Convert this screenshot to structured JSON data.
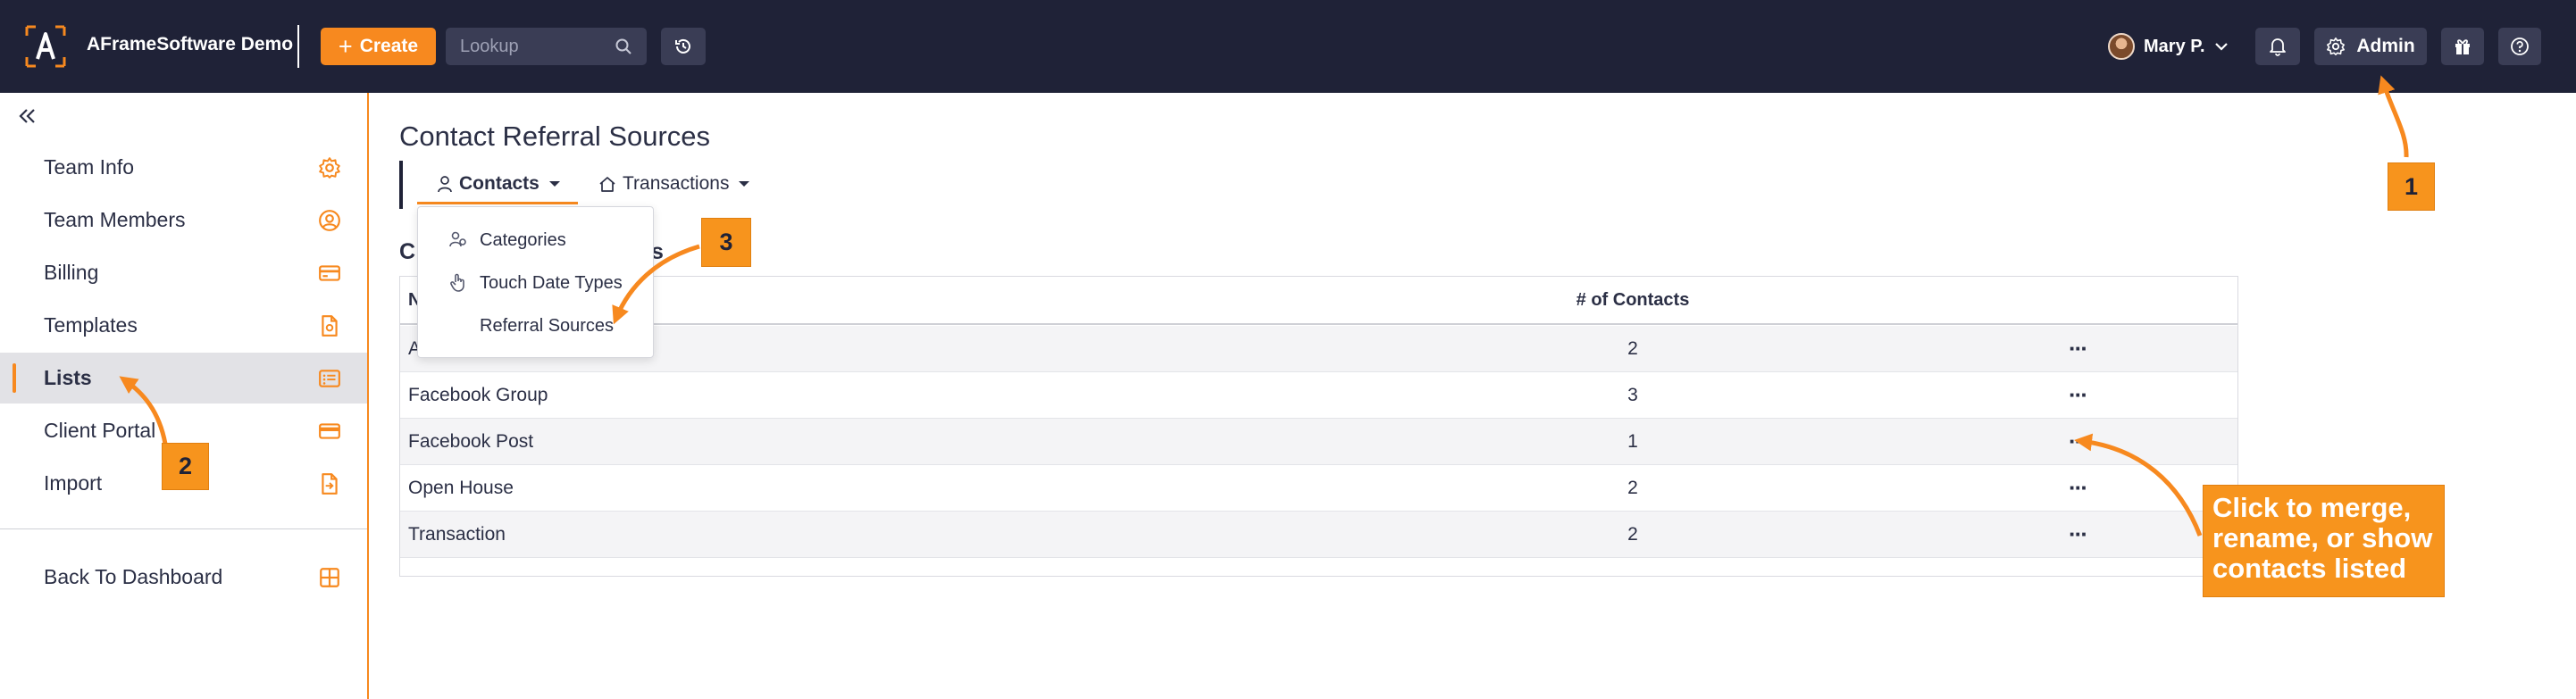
{
  "app": {
    "title": "AFrameSoftware Demo",
    "create_label": "Create",
    "lookup_placeholder": "Lookup",
    "user_name": "Mary P.",
    "admin_label": "Admin",
    "accent_color": "#f7891f",
    "topbar_color": "#1f2237"
  },
  "sidebar": {
    "items": [
      {
        "label": "Team Info",
        "icon": "gear-icon"
      },
      {
        "label": "Team Members",
        "icon": "user-circle-icon"
      },
      {
        "label": "Billing",
        "icon": "credit-card-icon"
      },
      {
        "label": "Templates",
        "icon": "document-icon"
      },
      {
        "label": "Lists",
        "icon": "list-icon",
        "active": true
      },
      {
        "label": "Client Portal",
        "icon": "card-icon"
      },
      {
        "label": "Import",
        "icon": "import-file-icon"
      }
    ],
    "back_label": "Back To Dashboard"
  },
  "main": {
    "page_title": "Contact Referral Sources",
    "tabs": [
      {
        "label": "Contacts",
        "icon": "person-icon",
        "active": true
      },
      {
        "label": "Transactions",
        "icon": "home-icon"
      }
    ],
    "section_heading_visible": "C",
    "section_heading_tail": "s",
    "dropdown": {
      "items": [
        {
          "label": "Categories",
          "icon": "people-icon"
        },
        {
          "label": "Touch Date Types",
          "icon": "hand-pointer-icon"
        },
        {
          "label": "Referral Sources",
          "icon": ""
        }
      ]
    },
    "table": {
      "columns": [
        "N",
        "# of Contacts"
      ],
      "rows": [
        {
          "name": "A",
          "count": "2"
        },
        {
          "name": "Facebook Group",
          "count": "3"
        },
        {
          "name": "Facebook Post",
          "count": "1"
        },
        {
          "name": "Open House",
          "count": "2"
        },
        {
          "name": "Transaction",
          "count": "2"
        }
      ],
      "row_menu_label": "···"
    }
  },
  "annotations": {
    "badge_1": "1",
    "badge_2": "2",
    "badge_3": "3",
    "callout": [
      "Click to merge,",
      "rename, or show",
      "contacts listed"
    ]
  }
}
